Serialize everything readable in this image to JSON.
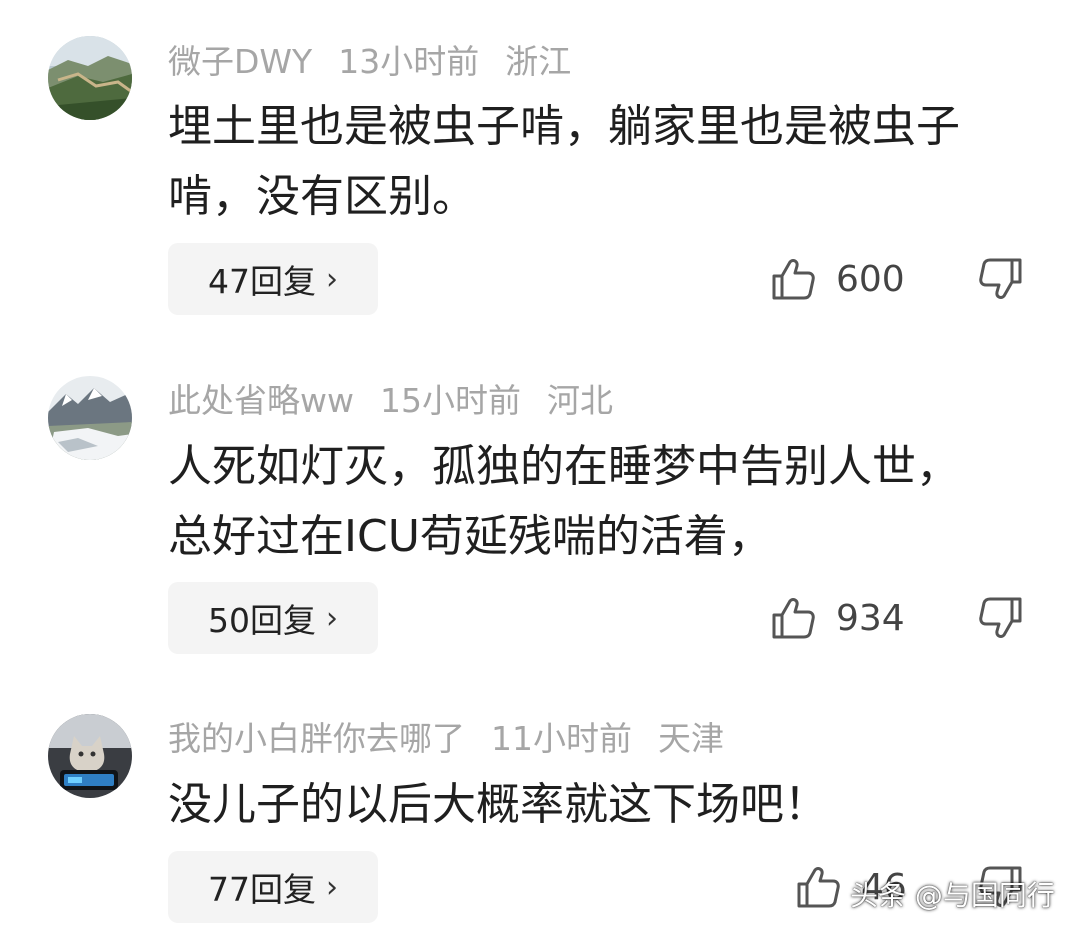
{
  "comments": [
    {
      "username": "微子DWY",
      "time": "13小时前",
      "location": "浙江",
      "text_line1": "埋土里也是被虫子啃，躺家里也是被虫子",
      "text_line2": "啃，没有区别。",
      "replies": "47回复",
      "likes": "600",
      "avatar_icon": "great-wall-landscape-avatar"
    },
    {
      "username": "此处省略ww",
      "time": "15小时前",
      "location": "河北",
      "text_line1": "人死如灯灭，孤独的在睡梦中告别人世，",
      "text_line2": "总好过在ICU苟延残喘的活着，",
      "replies": "50回复",
      "likes": "934",
      "avatar_icon": "snowy-mountain-avatar"
    },
    {
      "username": "我的小白胖你去哪了",
      "time": "11小时前",
      "location": "天津",
      "text_line1": "没儿子的以后大概率就这下场吧！",
      "text_line2": "",
      "replies": "77回复",
      "likes": "46",
      "avatar_icon": "cat-car-avatar"
    }
  ],
  "ui": {
    "reply_chevron": "›",
    "like_icon": "thumbs-up-icon",
    "dislike_icon": "thumbs-down-icon"
  },
  "watermark": {
    "text": "头条 @与国同行"
  },
  "colors": {
    "meta_gray": "#a6a6a6",
    "text_dark": "#1f1f1f",
    "button_bg": "#f4f4f4"
  }
}
